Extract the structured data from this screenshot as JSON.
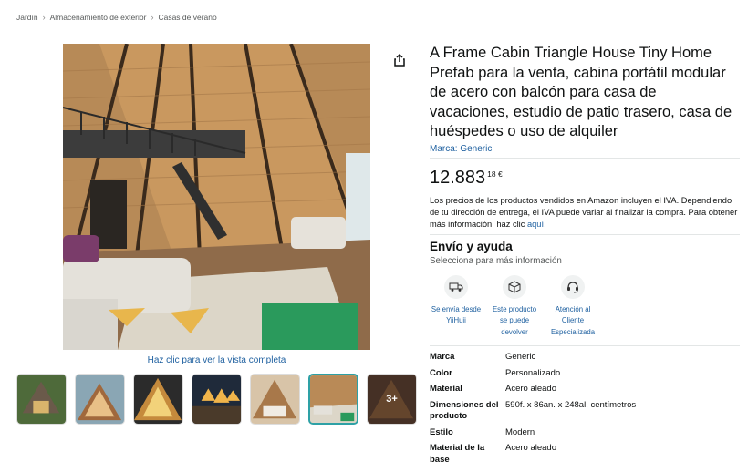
{
  "breadcrumb": [
    "Jardín",
    "Almacenamiento de exterior",
    "Casas de verano"
  ],
  "gallery": {
    "fullview_label": "Haz clic para ver la vista completa",
    "more_label": "3+"
  },
  "product": {
    "title": "A Frame Cabin Triangle House Tiny Home Prefab para la venta, cabina portátil modular de acero con balcón para casa de vacaciones, estudio de patio trasero, casa de huéspedes o uso de alquiler",
    "brand_label": "Marca: Generic",
    "price_whole": "12.883",
    "price_fraction": "18 €",
    "vat_text": "Los precios de los productos vendidos en Amazon incluyen el IVA. Dependiendo de tu dirección de entrega, el IVA puede variar al finalizar la compra. Para obtener más información, haz clic",
    "vat_link": "aquí",
    "vat_end": "."
  },
  "shipping": {
    "title": "Envío y ayuda",
    "subtitle": "Selecciona para más información",
    "features": [
      {
        "icon": "truck-icon",
        "label": "Se envía desde YiiHuii"
      },
      {
        "icon": "return-box-icon",
        "label": "Este producto se puede devolver"
      },
      {
        "icon": "headset-icon",
        "label": "Atención al Cliente Especializada"
      }
    ]
  },
  "specs": [
    {
      "key": "Marca",
      "value": "Generic"
    },
    {
      "key": "Color",
      "value": "Personalizado"
    },
    {
      "key": "Material",
      "value": "Acero aleado"
    },
    {
      "key": "Dimensiones del producto",
      "value": "590f. x 86an. x 248al. centímetros"
    },
    {
      "key": "Estilo",
      "value": "Modern"
    },
    {
      "key": "Material de la base",
      "value": "Acero aleado"
    }
  ],
  "colors": {
    "link": "#2162a1",
    "selected_thumb_border": "#2ea1a6"
  }
}
